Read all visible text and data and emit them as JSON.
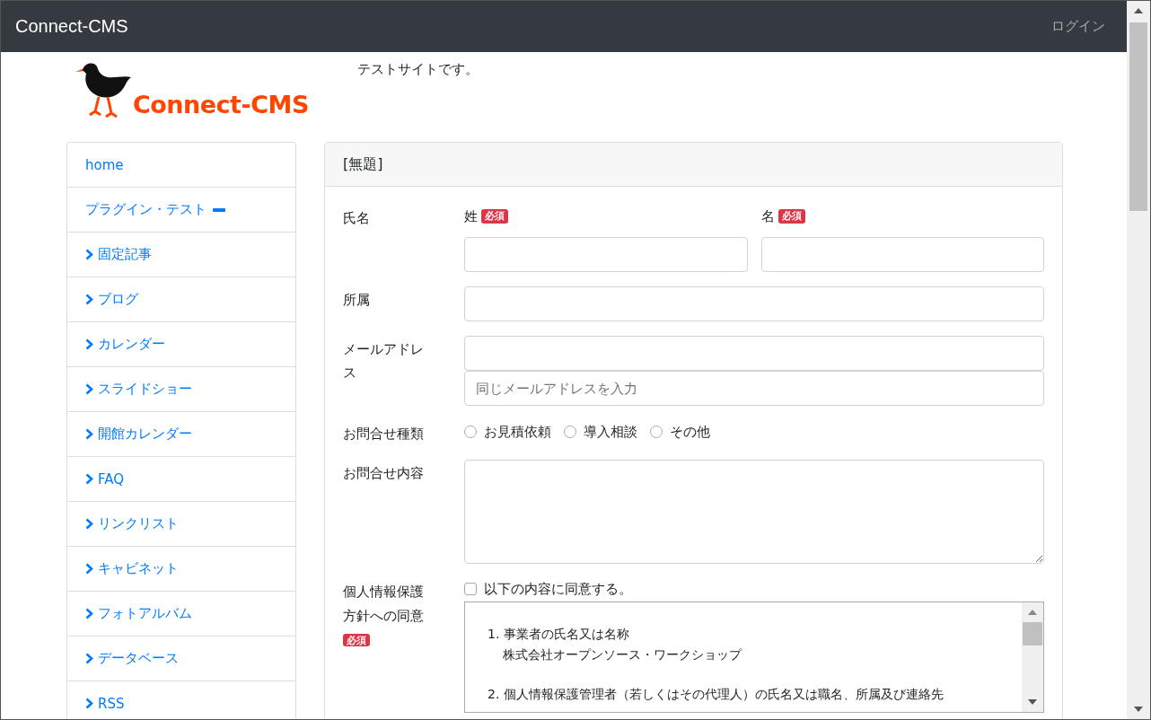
{
  "navbar": {
    "brand": "Connect-CMS",
    "login": "ログイン"
  },
  "header": {
    "logo_text": "Connect-CMS",
    "tagline": "テストサイトです。"
  },
  "sidebar": {
    "items": [
      {
        "label": "home",
        "selected": false
      },
      {
        "label": "プラグイン・テスト",
        "selected": false,
        "expanded": true,
        "children": [
          {
            "label": "固定記事",
            "selected": false
          },
          {
            "label": "ブログ",
            "selected": false
          },
          {
            "label": "カレンダー",
            "selected": false
          },
          {
            "label": "スライドショー",
            "selected": false
          },
          {
            "label": "開館カレンダー",
            "selected": false
          },
          {
            "label": "FAQ",
            "selected": false
          },
          {
            "label": "リンクリスト",
            "selected": false
          },
          {
            "label": "キャビネット",
            "selected": false
          },
          {
            "label": "フォトアルバム",
            "selected": false
          },
          {
            "label": "データベース",
            "selected": false
          },
          {
            "label": "RSS",
            "selected": false
          }
        ]
      }
    ]
  },
  "form": {
    "title": "[無題]",
    "name": {
      "label": "氏名",
      "last": {
        "label": "姓",
        "badge": "必須"
      },
      "first": {
        "label": "名",
        "badge": "必須"
      }
    },
    "affiliation": {
      "label": "所属"
    },
    "email": {
      "label": "メールアドレス",
      "confirm_placeholder": "同じメールアドレスを入力"
    },
    "inquiry_type": {
      "label": "お問合せ種類",
      "options": [
        {
          "label": "お見積依頼",
          "selected": false
        },
        {
          "label": "導入相談",
          "selected": false
        },
        {
          "label": "その他",
          "selected": false
        }
      ]
    },
    "inquiry_body": {
      "label": "お問合せ内容"
    },
    "privacy": {
      "label": "個人情報保護方針への同意",
      "badge": "必須",
      "checkbox": {
        "label": "以下の内容に同意する。",
        "checked": false
      },
      "policy": [
        {
          "heading": "1. 事業者の氏名又は名称",
          "body": "株式会社オープンソース・ワークショップ"
        },
        {
          "heading": "2. 個人情報保護管理者（若しくはその代理人）の氏名又は職名、所属及び連絡先"
        }
      ]
    }
  }
}
